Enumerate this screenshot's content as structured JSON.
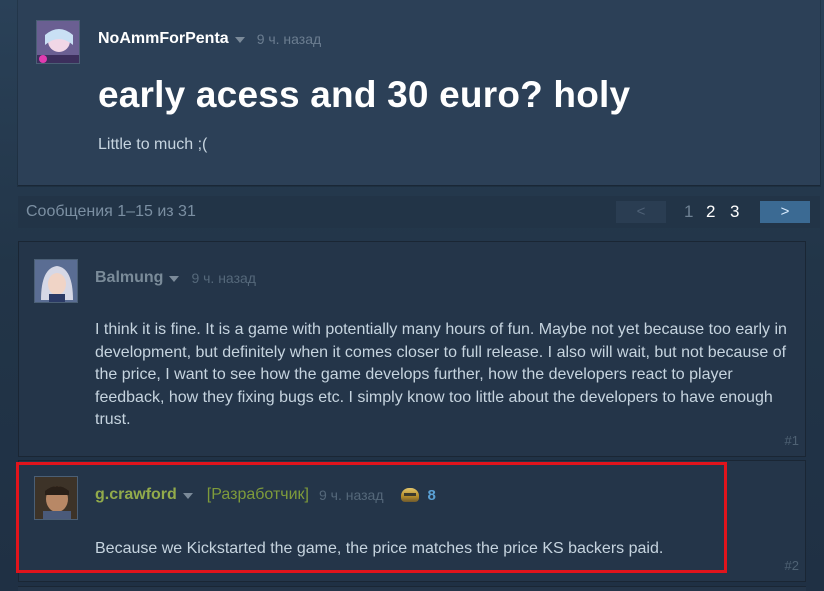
{
  "op": {
    "author": "NoAmmForPenta",
    "time": "9 ч. назад",
    "title": "early acess and 30 euro? holy",
    "body": "Little to much ;("
  },
  "pagination": {
    "info": "Сообщения 1–15 из 31",
    "prev": "<",
    "pages": [
      "1",
      "2",
      "3"
    ],
    "next": ">"
  },
  "replies": [
    {
      "author": "Balmung",
      "time": "9 ч. назад",
      "body": "I think it is fine. It is a game with potentially many hours of fun. Maybe not yet because too early in development, but definitely when it comes closer to full release. I also will wait, but not because of the price, I want to see how the game develops further, how the developers react to player feedback, how they fixing bugs etc. I simply know too little about the developers to have enough trust.",
      "num": "#1"
    },
    {
      "author": "g.crawford",
      "tag": "[Разработчик]",
      "time": "9 ч. назад",
      "award_count": "8",
      "body": "Because we Kickstarted the game, the price matches the price KS backers paid.",
      "num": "#2"
    }
  ]
}
